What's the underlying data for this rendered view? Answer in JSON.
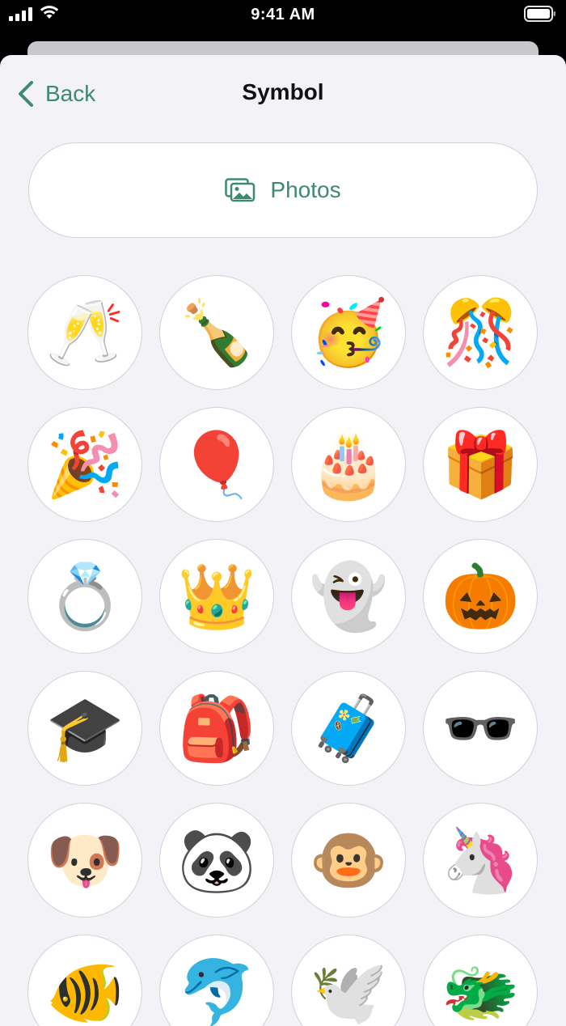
{
  "status_bar": {
    "time": "9:41 AM"
  },
  "nav": {
    "back_label": "Back",
    "title": "Symbol"
  },
  "photos_button": {
    "label": "Photos"
  },
  "colors": {
    "accent": "#3d8a73",
    "sheet_bg": "#f2f2f7",
    "cell_border": "#d1d1d6"
  },
  "symbols": [
    {
      "name": "clinking-glasses",
      "glyph": "🥂"
    },
    {
      "name": "champagne-bottle",
      "glyph": "🍾"
    },
    {
      "name": "partying-face",
      "glyph": "🥳"
    },
    {
      "name": "confetti-ball",
      "glyph": "🎊"
    },
    {
      "name": "party-popper",
      "glyph": "🎉"
    },
    {
      "name": "balloon",
      "glyph": "🎈"
    },
    {
      "name": "birthday-cake",
      "glyph": "🎂"
    },
    {
      "name": "wrapped-gift",
      "glyph": "🎁"
    },
    {
      "name": "ring",
      "glyph": "💍"
    },
    {
      "name": "crown",
      "glyph": "👑"
    },
    {
      "name": "ghost",
      "glyph": "👻"
    },
    {
      "name": "jack-o-lantern",
      "glyph": "🎃"
    },
    {
      "name": "graduation-cap",
      "glyph": "🎓"
    },
    {
      "name": "backpack",
      "glyph": "🎒"
    },
    {
      "name": "luggage",
      "glyph": "🧳"
    },
    {
      "name": "sunglasses",
      "glyph": "🕶️"
    },
    {
      "name": "dog-face",
      "glyph": "🐶"
    },
    {
      "name": "panda",
      "glyph": "🐼"
    },
    {
      "name": "monkey-face",
      "glyph": "🐵"
    },
    {
      "name": "unicorn",
      "glyph": "🦄"
    },
    {
      "name": "tropical-fish",
      "glyph": "🐠"
    },
    {
      "name": "dolphin",
      "glyph": "🐬"
    },
    {
      "name": "dove",
      "glyph": "🕊️"
    },
    {
      "name": "dragon-face",
      "glyph": "🐲"
    }
  ]
}
